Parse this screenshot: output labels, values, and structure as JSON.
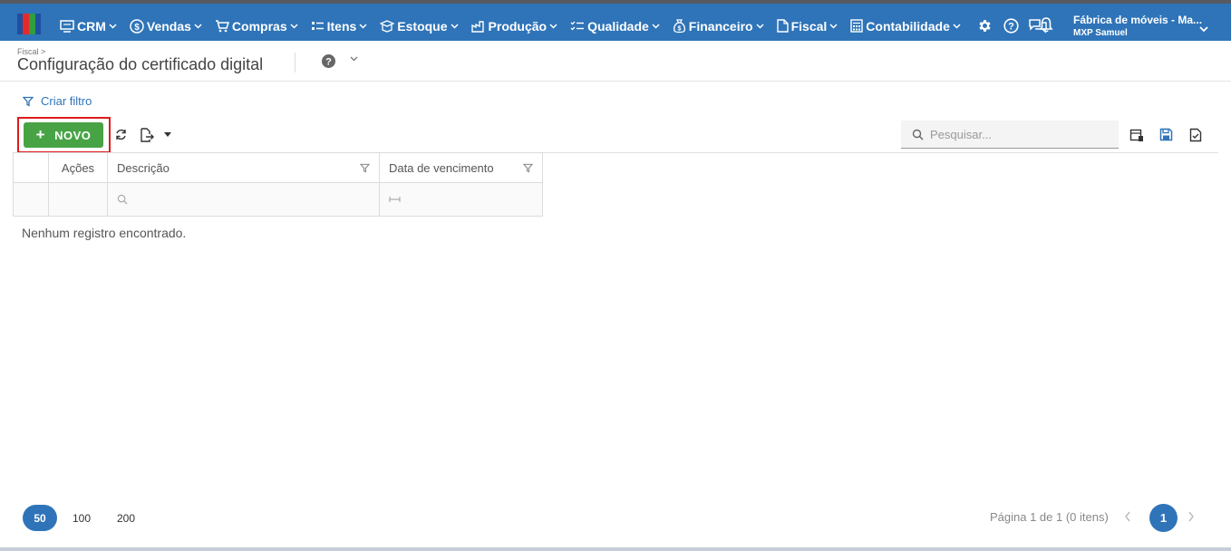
{
  "nav": {
    "items": [
      {
        "label": "CRM",
        "icon": "crm-icon"
      },
      {
        "label": "Vendas",
        "icon": "dollar-circle-icon"
      },
      {
        "label": "Compras",
        "icon": "cart-icon"
      },
      {
        "label": "Itens",
        "icon": "items-icon"
      },
      {
        "label": "Estoque",
        "icon": "box-icon"
      },
      {
        "label": "Produção",
        "icon": "factory-icon"
      },
      {
        "label": "Qualidade",
        "icon": "checklist-icon"
      },
      {
        "label": "Financeiro",
        "icon": "money-bag-icon"
      },
      {
        "label": "Fiscal",
        "icon": "document-icon"
      },
      {
        "label": "Contabilidade",
        "icon": "calculator-icon"
      }
    ],
    "company_name": "Fábrica de móveis - Ma...",
    "user_name": "MXP Samuel",
    "brand_color": "#2f74b8"
  },
  "header": {
    "breadcrumb": "Fiscal >",
    "title": "Configuração do certificado digital"
  },
  "toolbar": {
    "filter_label": "Criar filtro",
    "new_label": "NOVO",
    "search_placeholder": "Pesquisar...",
    "new_button_color": "#48a345",
    "highlight_color": "#e01b1b"
  },
  "grid": {
    "columns": [
      "Ações",
      "Descrição",
      "Data de vencimento"
    ],
    "empty_message": "Nenhum registro encontrado."
  },
  "pager": {
    "sizes": [
      "50",
      "100",
      "200"
    ],
    "active_size": "50",
    "info": "Página 1 de 1 (0 itens)",
    "current_page": "1"
  }
}
